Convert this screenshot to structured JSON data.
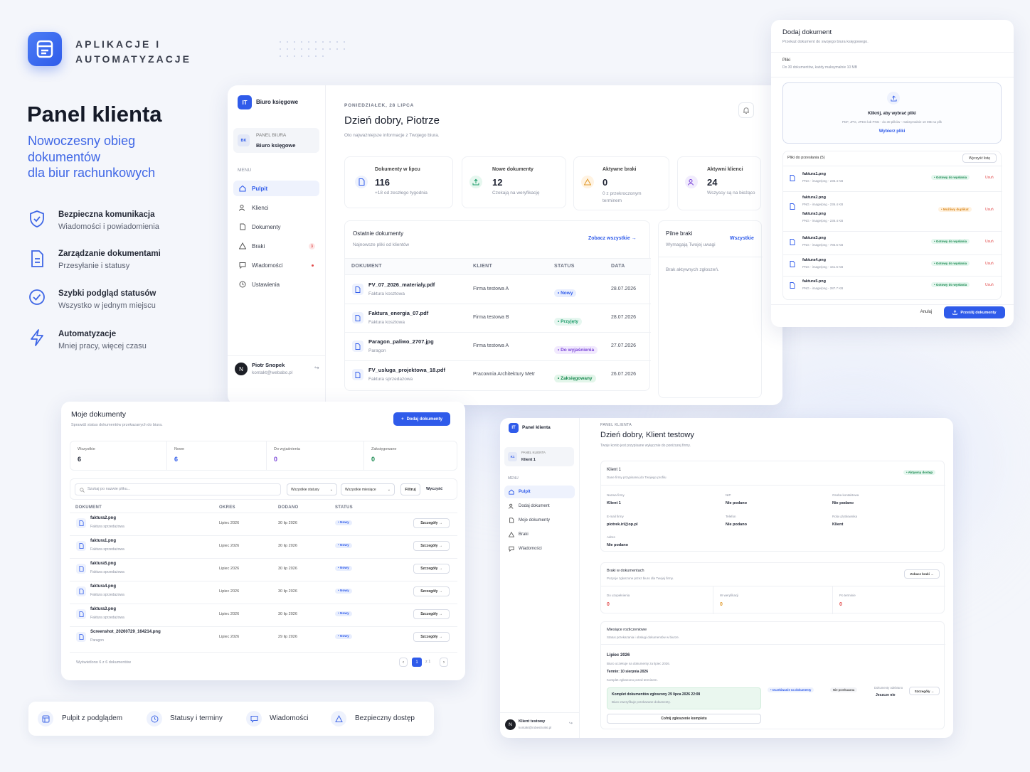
{
  "brand": {
    "name_line1": "APLIKACJE I",
    "name_line2": "AUTOMATYZACJE"
  },
  "hero": {
    "title": "Panel klienta",
    "subtitle_l1": "Nowoczesny obieg",
    "subtitle_l2": "dokumentów",
    "subtitle_l3": "dla biur rachunkowych"
  },
  "features": [
    {
      "title": "Bezpieczna komunikacja",
      "desc": "Wiadomości i powiadomienia",
      "icon": "shield-icon"
    },
    {
      "title": "Zarządzanie dokumentami",
      "desc": "Przesyłanie i statusy",
      "icon": "document-icon"
    },
    {
      "title": "Szybki podgląd statusów",
      "desc": "Wszystko w jednym miejscu",
      "icon": "check-circle-icon"
    },
    {
      "title": "Automatyzacje",
      "desc": "Mniej pracy, więcej czasu",
      "icon": "bolt-icon"
    }
  ],
  "bottom_features": [
    "Pulpit z podglądem",
    "Statusy i terminy",
    "Wiadomości",
    "Bezpieczny dostęp"
  ],
  "office": {
    "sidebar": {
      "logo": "IT",
      "app_name": "Biuro księgowe",
      "account_badge": "BK",
      "account_label": "PANEL BIURA",
      "account_name": "Biuro księgowe",
      "menu_label": "MENU",
      "items": [
        "Pulpit",
        "Klienci",
        "Dokumenty",
        "Braki",
        "Wiadomości",
        "Ustawienia"
      ],
      "braki_count": "3",
      "user_initial": "N",
      "user_name": "Piotr Snopek",
      "user_email": "kontakt@webabo.pl"
    },
    "date": "PONIEDZIAŁEK, 28 LIPCA",
    "greeting": "Dzień dobry, Piotrze",
    "greeting_sub": "Oto najważniejsze informacje z Twojego biura.",
    "stats": [
      {
        "label": "Dokumenty w lipcu",
        "value": "116",
        "sub": "+18 od zeszłego tygodnia"
      },
      {
        "label": "Nowe dokumenty",
        "value": "12",
        "sub": "Czekają na weryfikację"
      },
      {
        "label": "Aktywne braki",
        "value": "0",
        "sub": "0 z przekroczonym terminem"
      },
      {
        "label": "Aktywni klienci",
        "value": "24",
        "sub": "Wszyscy są na bieżąco"
      }
    ],
    "recent": {
      "title": "Ostatnie dokumenty",
      "sub": "Najnowsze pliki od klientów",
      "link": "Zobacz wszystkie",
      "headers": [
        "DOKUMENT",
        "KLIENT",
        "STATUS",
        "DATA"
      ],
      "rows": [
        {
          "name": "FV_07_2026_materialy.pdf",
          "type": "Faktura kosztowa",
          "client": "Firma testowa A",
          "status": "Nowy",
          "date": "28.07.2026"
        },
        {
          "name": "Faktura_energia_07.pdf",
          "type": "Faktura kosztowa",
          "client": "Firma testowa B",
          "status": "Przyjęty",
          "date": "28.07.2026"
        },
        {
          "name": "Paragon_paliwo_2707.jpg",
          "type": "Paragon",
          "client": "Firma testowa A",
          "status": "Do wyjaśnienia",
          "date": "27.07.2026"
        },
        {
          "name": "FV_usluga_projektowa_18.pdf",
          "type": "Faktura sprzedażowa",
          "client": "Pracownia Architektury Metr",
          "status": "Zaksięgowany",
          "date": "26.07.2026"
        }
      ]
    },
    "urgent": {
      "title": "Pilne braki",
      "link": "Wszystkie",
      "sub": "Wymagają Twojej uwagi",
      "empty": "Brak aktywnych zgłoszeń."
    }
  },
  "upload": {
    "title": "Dodaj dokument",
    "sub": "Przekaż dokument do swojego biura księgowego.",
    "files_label": "Pliki",
    "files_hint": "Do 30 dokumentów, każdy maksymalnie 10 MB",
    "drop_title": "Kliknij, aby wybrać pliki",
    "drop_hint": "PDF, JPG, JPEG lub PNG - do 30 plików - maksymalnie 10 MB na plik",
    "drop_link": "Wybierz pliki",
    "queue_label": "Pliki do przesłania (5)",
    "clear": "Wyczyść listę",
    "files": [
      {
        "name": "faktura1.png",
        "meta": "PNG - image/png - 236.4 KB",
        "status": "Gotowy do wysłania"
      },
      {
        "name": "faktura2.png",
        "meta": "PNG - image/png - 236.4 KB",
        "status": "Możliwy duplikat",
        "dup_name": "faktura3.png",
        "dup_meta": "PNG - image/png - 236.4 KB"
      },
      {
        "name": "faktura3.png",
        "meta": "PNG - image/png - 786.5 KB",
        "status": "Gotowy do wysłania"
      },
      {
        "name": "faktura4.png",
        "meta": "PNG - image/png - 161.6 KB",
        "status": "Gotowy do wysłania"
      },
      {
        "name": "faktura5.png",
        "meta": "PNG - image/png - 287.7 KB",
        "status": "Gotowy do wysłania"
      }
    ],
    "remove": "Usuń",
    "cancel": "Anuluj",
    "submit": "Prześlij dokumenty"
  },
  "mydocs": {
    "title": "Moje dokumenty",
    "sub": "Sprawdź status dokumentów przekazanych do biura.",
    "add": "Dodaj dokumenty",
    "stats": [
      {
        "label": "Wszystkie",
        "value": "6"
      },
      {
        "label": "Nowe",
        "value": "6"
      },
      {
        "label": "Do wyjaśnienia",
        "value": "0"
      },
      {
        "label": "Zaksięgowane",
        "value": "0"
      }
    ],
    "search_ph": "Szukaj po nazwie pliku...",
    "filter_status": "Wszystkie statusy",
    "filter_month": "Wszystkie miesiące",
    "filter_btn": "Filtruj",
    "clear_btn": "Wyczyść",
    "headers": [
      "DOKUMENT",
      "OKRES",
      "DODANO",
      "STATUS"
    ],
    "rows": [
      {
        "name": "faktura2.png",
        "type": "Faktura sprzedażowa",
        "period": "Lipiec 2026",
        "added": "30 lip 2026",
        "status": "Nowy"
      },
      {
        "name": "faktura1.png",
        "type": "Faktura sprzedażowa",
        "period": "Lipiec 2026",
        "added": "30 lip 2026",
        "status": "Nowy"
      },
      {
        "name": "faktura5.png",
        "type": "Faktura sprzedażowa",
        "period": "Lipiec 2026",
        "added": "30 lip 2026",
        "status": "Nowy"
      },
      {
        "name": "faktura4.png",
        "type": "Faktura sprzedażowa",
        "period": "Lipiec 2026",
        "added": "30 lip 2026",
        "status": "Nowy"
      },
      {
        "name": "faktura3.png",
        "type": "Faktura sprzedażowa",
        "period": "Lipiec 2026",
        "added": "30 lip 2026",
        "status": "Nowy"
      },
      {
        "name": "Screenshot_20260729_164214.png",
        "type": "Paragon",
        "period": "Lipiec 2026",
        "added": "29 lip 2026",
        "status": "Nowy"
      }
    ],
    "details": "Szczegóły",
    "footer": "Wyświetlono 6 z 6 dokumentów",
    "page": "1",
    "page_of": "z 1"
  },
  "client": {
    "sidebar": {
      "logo": "IT",
      "app_name": "Panel klienta",
      "account_badge": "K1",
      "account_label": "PANEL KLIENTA",
      "account_name": "Klient 1",
      "menu_label": "MENU",
      "items": [
        "Pulpit",
        "Dodaj dokument",
        "Moje dokumenty",
        "Braki",
        "Wiadomości"
      ],
      "user_initial": "N",
      "user_name": "Klient testowy",
      "user_email": "kontakt@robestronki.pl"
    },
    "label": "PANEL KLIENTA",
    "greeting": "Dzień dobry, Klient testowy",
    "greeting_sub": "Twoje konto jest przypisane wyłącznie do poniższej firmy.",
    "company": {
      "title": "Klient 1",
      "sub": "Dane firmy przypisanej do Twojego profilu",
      "badge": "Aktywny dostęp",
      "fields": [
        {
          "label": "Nazwa firmy",
          "value": "Klient 1"
        },
        {
          "label": "NIP",
          "value": "Nie podano"
        },
        {
          "label": "Osoba kontaktowa",
          "value": "Nie podano"
        },
        {
          "label": "E-mail firmy",
          "value": "piotrek.irl@op.pl"
        },
        {
          "label": "Telefon",
          "value": "Nie podano"
        },
        {
          "label": "Rola użytkownika",
          "value": "Klient"
        },
        {
          "label": "Adres",
          "value": "Nie podano"
        }
      ]
    },
    "gaps": {
      "title": "Braki w dokumentach",
      "sub": "Pozycje zgłoszone przez biuro dla Twojej firmy.",
      "link": "Zobacz braki",
      "cols": [
        {
          "label": "Do uzupełnienia",
          "value": "0"
        },
        {
          "label": "W weryfikacji",
          "value": "0"
        },
        {
          "label": "Po terminie",
          "value": "0"
        }
      ]
    },
    "settlement": {
      "title": "Miesiące rozliczeniowe",
      "sub": "Status przekazania i obsługi dokumentów w biurze.",
      "month": "Lipiec 2026",
      "month_sub": "Biuro oczekuje na dokumenty za lipiec 2026.",
      "deadline": "Termin: 10 sierpnia 2026",
      "note": "Komplet zgłoszono przed terminem.",
      "box_title": "Komplet dokumentów zgłoszony 29 lipca 2026 22:08",
      "box_sub": "Biuro zweryfikuje przekazane dokumenty.",
      "status1": "Oczekiwanie na dokumenty",
      "status2": "Nie przekazana",
      "received_label": "Dokumenty odebrano",
      "received_value": "Jeszcze nie",
      "details": "Szczegóły",
      "revert": "Cofnij zgłoszenie kompletu"
    }
  }
}
